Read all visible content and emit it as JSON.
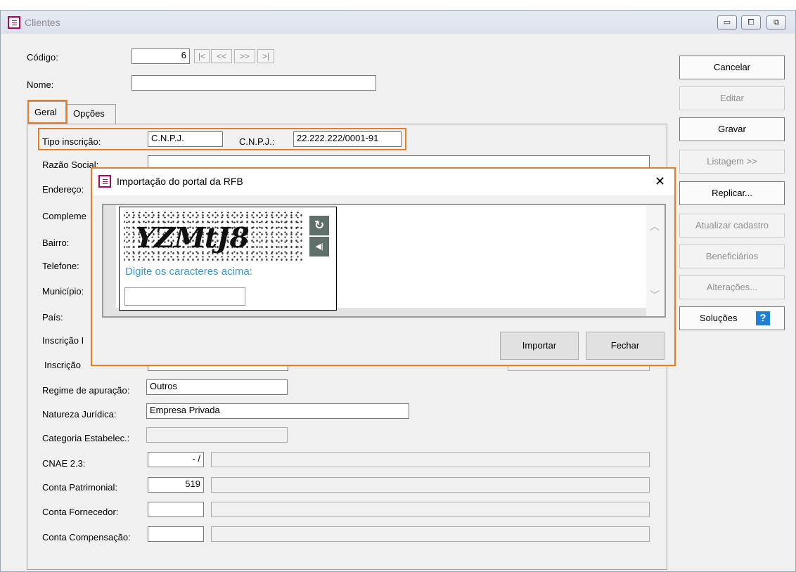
{
  "window": {
    "title": "Clientes",
    "controls": {
      "minimize": "▭",
      "maximize": "⧠",
      "close": "⧉"
    }
  },
  "record": {
    "codigo_label": "Código:",
    "codigo_value": "6",
    "nav": [
      "|<",
      "<<",
      ">>",
      ">|"
    ],
    "nome_label": "Nome:",
    "nome_value": ""
  },
  "tabs": [
    {
      "label": "Geral",
      "active": true
    },
    {
      "label": "Opções",
      "active": false
    }
  ],
  "form": {
    "tipo_inscricao_label": "Tipo inscrição:",
    "tipo_inscricao_value": "C.N.P.J.",
    "cnpj_label": "C.N.P.J.:",
    "cnpj_value": "22.222.222/0001-91",
    "razao_social_label": "Razão Social:",
    "endereco_label": "Endereço:",
    "complemento_label": "Compleme",
    "bairro_label": "Bairro:",
    "telefone_label": "Telefone:",
    "municipio_label": "Município:",
    "pais_label": "País:",
    "inscricao1_label": "Inscrição I",
    "inscricao2_label": "Inscrição",
    "regime_label": "Regime de apuração:",
    "regime_value": "Outros",
    "natureza_label": "Natureza Jurídica:",
    "natureza_value": "Empresa Privada",
    "categoria_label": "Categoria Estabelec.:",
    "categoria_value": "",
    "cnae_label": "CNAE 2.3:",
    "cnae_value": "- /",
    "conta_patrimonial_label": "Conta Patrimonial:",
    "conta_patrimonial_value": "519",
    "conta_fornecedor_label": "Conta Fornecedor:",
    "conta_fornecedor_value": "",
    "conta_compensacao_label": "Conta Compensação:",
    "conta_compensacao_value": ""
  },
  "side_buttons": {
    "cancelar": "Cancelar",
    "editar": "Editar",
    "gravar": "Gravar",
    "listagem": "Listagem >>",
    "replicar": "Replicar...",
    "atualizar": "Atualizar cadastro",
    "beneficiarios": "Beneficiários",
    "alteracoes": "Alterações...",
    "solucoes": "Soluções",
    "solucoes_icon": "?"
  },
  "dialog": {
    "title": "Importação do portal da RFB",
    "close": "✕",
    "captcha_image_text": "YZMtJ8",
    "captcha_prompt": "Digite os caracteres acima:",
    "captcha_input_value": "",
    "refresh_icon": "↻",
    "audio_icon": "◀|",
    "importar": "Importar",
    "fechar": "Fechar"
  },
  "colors": {
    "highlight": "#f07a1e",
    "captcha_prompt": "#3a9ad9",
    "help_icon": "#1e7fd6",
    "app_icon": "#b7005a"
  }
}
